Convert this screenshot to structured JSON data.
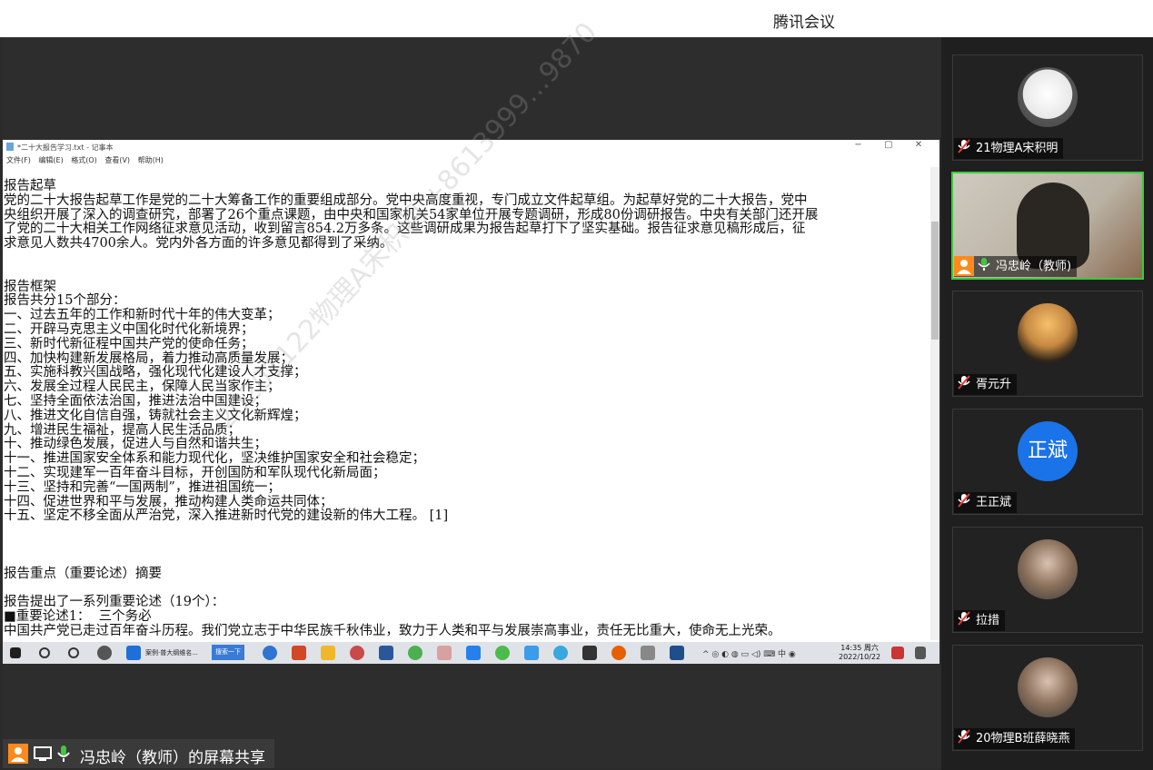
{
  "app_title": "腾讯会议",
  "notepad": {
    "title": "*二十大报告学习.txt - 记事本",
    "window_buttons": [
      "−",
      "▢",
      "✕"
    ],
    "menu": [
      "文件(F)",
      "编辑(E)",
      "格式(O)",
      "查看(V)",
      "帮助(H)"
    ],
    "lines": [
      "报告起草",
      "党的二十大报告起草工作是党的二十大筹备工作的重要组成部分。党中央高度重视，专门成立文件起草组。为起草好党的二十大报告，党中",
      "央组织开展了深入的调查研究，部署了26个重点课题，由中央和国家机关54家单位开展专题调研，形成80份调研报告。中央有关部门还开展",
      "了党的二十大相关工作网络征求意见活动，收到留言854.2万多条。这些调研成果为报告起草打下了坚实基础。报告征求意见稿形成后，征",
      "求意见人数共4700余人。党内外各方面的许多意见都得到了采纳。",
      "",
      "",
      "报告框架",
      "报告共分15个部分：",
      "一、过去五年的工作和新时代十年的伟大变革；",
      "二、开辟马克思主义中国化时代化新境界；",
      "三、新时代新征程中国共产党的使命任务；",
      "四、加快构建新发展格局，着力推动高质量发展；",
      "五、实施科教兴国战略，强化现代化建设人才支撑；",
      "六、发展全过程人民民主，保障人民当家作主；",
      "七、坚持全面依法治国，推进法治中国建设；",
      "八、推进文化自信自强，铸就社会主义文化新辉煌；",
      "九、增进民生福祉，提高人民生活品质；",
      "十、推动绿色发展，促进人与自然和谐共生；",
      "十一、推进国家安全体系和能力现代化，坚决维护国家安全和社会稳定；",
      "十二、实现建军一百年奋斗目标，开创国防和军队现代化新局面；",
      "十三、坚持和完善“一国两制”，推进祖国统一；",
      "十四、促进世界和平与发展，推动构建人类命运共同体；",
      "十五、坚定不移全面从严治党，深入推进新时代党的建设新的伟大工程。 [1]",
      "",
      "",
      "",
      "报告重点（重要论述）摘要",
      "",
      "报告提出了一系列重要论述（19个）：",
      "■重要论述1：  三个务必",
      "中国共产党已走过百年奋斗历程。我们党立志于中华民族千秋伟业，致力于人类和平与发展崇高事业，责任无比重大，使命无上光荣。"
    ]
  },
  "taskbar": {
    "edge_tab_label": "案例·普大纲维名...",
    "search_label": "搜索一下",
    "clock_time": "14:35 周六",
    "clock_date": "2022/10/22"
  },
  "watermark": "20201122物理A宋积明 +8613999…9870",
  "share_label": "冯忠岭（教师）的屏幕共享",
  "participants": [
    {
      "name": "21物理A宋积明",
      "mic": "off",
      "avatar": "cartoon-face-avatar",
      "host": false
    },
    {
      "name": "冯忠岭（教师)",
      "mic": "on",
      "avatar": "camera-video",
      "host": true
    },
    {
      "name": "胥元升",
      "mic": "off",
      "avatar": "sunset-tree-avatar",
      "host": false
    },
    {
      "name": "王正斌",
      "mic": "off",
      "avatar": "text-avatar",
      "avatar_text": "正斌",
      "host": false
    },
    {
      "name": "拉措",
      "mic": "off",
      "avatar": "photo-avatar",
      "host": false
    },
    {
      "name": "20物理B班薛晓燕",
      "mic": "off",
      "avatar": "photo-avatar",
      "host": false
    }
  ],
  "colors": {
    "accent_green": "#3ec93e",
    "host_orange": "#ff8a1c",
    "avatar_blue": "#1a73e8"
  }
}
